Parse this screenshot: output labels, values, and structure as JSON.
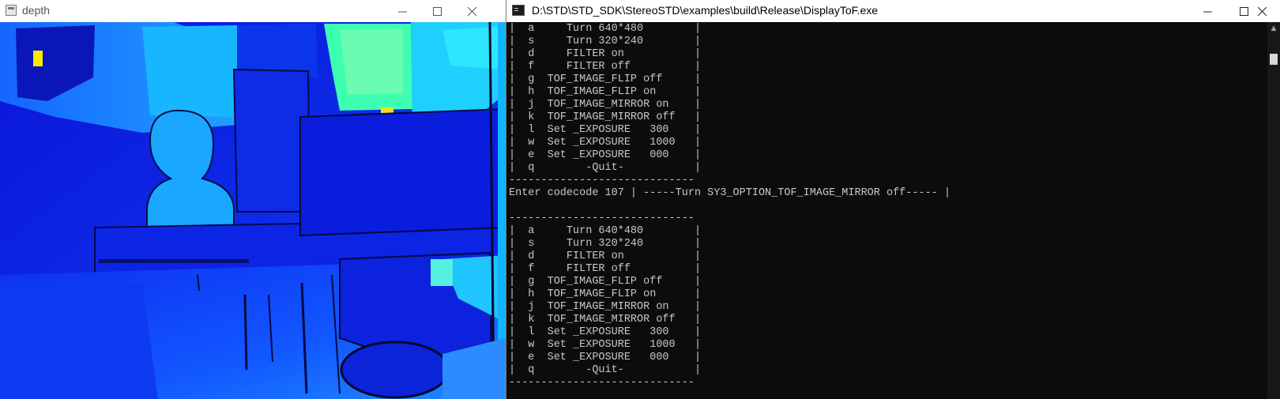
{
  "depth_window": {
    "title": "depth",
    "minimize_icon": "minimize-icon",
    "maximize_icon": "maximize-icon",
    "close_icon": "close-icon"
  },
  "console_window": {
    "title": "D:\\STD\\STD_SDK\\StereoSTD\\examples\\build\\Release\\DisplayToF.exe",
    "minimize_icon": "minimize-icon",
    "maximize_icon": "maximize-icon",
    "close_icon": "close-icon",
    "lines": [
      "|  a     Turn 640*480        |",
      "|  s     Turn 320*240        |",
      "|  d     FILTER on           |",
      "|  f     FILTER off          |",
      "|  g  TOF_IMAGE_FLIP off     |",
      "|  h  TOF_IMAGE_FLIP on      |",
      "|  j  TOF_IMAGE_MIRROR on    |",
      "|  k  TOF_IMAGE_MIRROR off   |",
      "|  l  Set _EXPOSURE   300    |",
      "|  w  Set _EXPOSURE   1000   |",
      "|  e  Set _EXPOSURE   000    |",
      "|  q        -Quit-           |",
      "-----------------------------",
      "Enter codecode 107 | -----Turn SY3_OPTION_TOF_IMAGE_MIRROR off----- |",
      "",
      "-----------------------------",
      "|  a     Turn 640*480        |",
      "|  s     Turn 320*240        |",
      "|  d     FILTER on           |",
      "|  f     FILTER off          |",
      "|  g  TOF_IMAGE_FLIP off     |",
      "|  h  TOF_IMAGE_FLIP on      |",
      "|  j  TOF_IMAGE_MIRROR on    |",
      "|  k  TOF_IMAGE_MIRROR off   |",
      "|  l  Set _EXPOSURE   300    |",
      "|  w  Set _EXPOSURE   1000   |",
      "|  e  Set _EXPOSURE   000    |",
      "|  q        -Quit-           |",
      "-----------------------------"
    ]
  },
  "colors": {
    "console_bg": "#0c0c0c",
    "console_text": "#c8c8c8",
    "depth_far": "#0a1fe0",
    "depth_mid": "#1fb8ff",
    "depth_near": "#7cff9a",
    "depth_hot": "#ffe800"
  }
}
